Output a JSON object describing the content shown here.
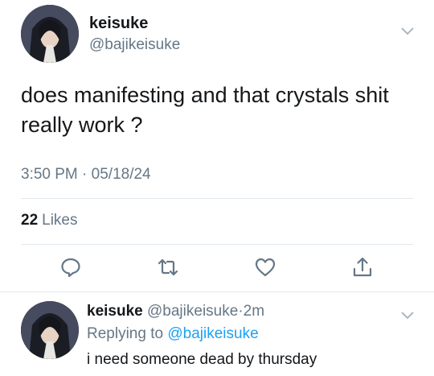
{
  "tweet": {
    "display_name": "keisuke",
    "handle": "@bajikeisuke",
    "text": "does manifesting and that crystals shit really work ?",
    "time": "3:50 PM",
    "dot": "·",
    "date": "05/18/24",
    "likes_count": "22",
    "likes_label": "Likes",
    "actions": [
      "reply-icon",
      "retweet-icon",
      "like-icon",
      "share-icon"
    ]
  },
  "reply": {
    "display_name": "keisuke",
    "handle": "@bajikeisuke",
    "dot": "·",
    "age": "2m",
    "replying_prefix": "Replying to",
    "replying_to": "@bajikeisuke",
    "text": "i need someone dead by thursday"
  },
  "colors": {
    "text": "#14171a",
    "secondary": "#657786",
    "link": "#1da1f2",
    "divider": "#e1e8ed"
  }
}
